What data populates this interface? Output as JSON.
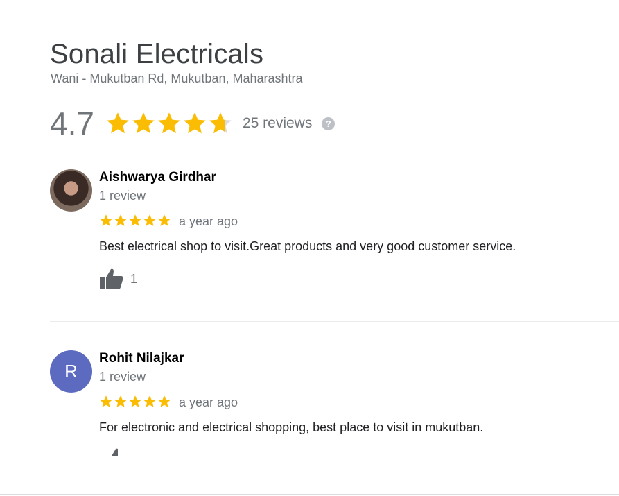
{
  "place": {
    "name": "Sonali Electricals",
    "address": "Wani - Mukutban Rd, Mukutban, Maharashtra"
  },
  "rating": {
    "value": "4.7",
    "stars": 4.7,
    "star_color": "#fbbc04",
    "reviews_label": "25 reviews",
    "help_icon": "?"
  },
  "reviews": [
    {
      "name": "Aishwarya Girdhar",
      "review_count": "1 review",
      "stars": 5,
      "time": "a year ago",
      "text": "Best electrical shop to visit.Great products and very good customer service.",
      "likes": "1",
      "avatar": "photo"
    },
    {
      "name": "Rohit Nilajkar",
      "review_count": "1 review",
      "stars": 5,
      "time": "a year ago",
      "text": "For electronic and electrical shopping, best place to visit in mukutban.",
      "avatar_letter": "R",
      "avatar_color": "#5c6bc0"
    }
  ],
  "colors": {
    "thumb": "#5f6368",
    "empty_star": "#dadce0"
  }
}
